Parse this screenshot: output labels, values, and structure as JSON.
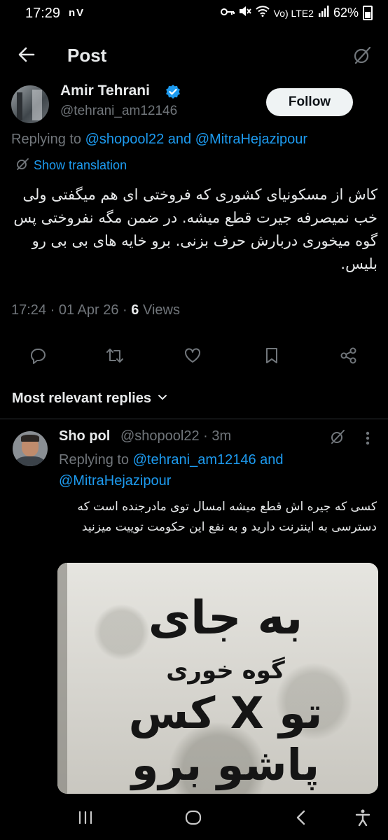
{
  "status_bar": {
    "time": "17:29",
    "left_icons": "nV",
    "network_label": "Vo) LTE2",
    "battery": "62%"
  },
  "header": {
    "title": "Post"
  },
  "tweet": {
    "author_name": "Amir Tehrani",
    "author_handle": "@tehrani_am12146",
    "follow_label": "Follow",
    "replying_prefix": "Replying to",
    "replying_user1": "@shopool22",
    "replying_and": "and",
    "replying_user2": "@MitraHejazipour",
    "translate_label": "Show translation",
    "text": "کاش از مسکونیای کشوری که فروختی ای هم میگفتی ولی خب نمیصرفه جیرت قطع میشه. در ضمن مگه نفروختی پس گوه میخوری دربارش حرف بزنی. برو خایه های بی بی رو بلیس.",
    "time": "17:24",
    "date": "01 Apr 26",
    "views_count": "6",
    "views_label": "Views"
  },
  "sort": {
    "label": "Most relevant replies"
  },
  "reply": {
    "author_name": "Sho pol",
    "author_handle": "@shopool22 · 3m",
    "replying_prefix": "Replying to",
    "replying_user1": "@tehrani_am12146",
    "replying_and": "and",
    "replying_user2": "@MitraHejazipour",
    "text": "کسی که جیره اش قطع میشه امسال توی مادرجنده است که دسترسی به اینترنت دارید و به نفع این حکومت توییت میزنید",
    "image_text": {
      "line1": "به جای",
      "line2": "گوه خوری",
      "line3": "تو X کس",
      "line4": "پاشو برو"
    }
  },
  "colors": {
    "background": "#000000",
    "text": "#e7e9ea",
    "muted": "#71767b",
    "link": "#1d9bf0",
    "verified": "#1d9bf0"
  }
}
